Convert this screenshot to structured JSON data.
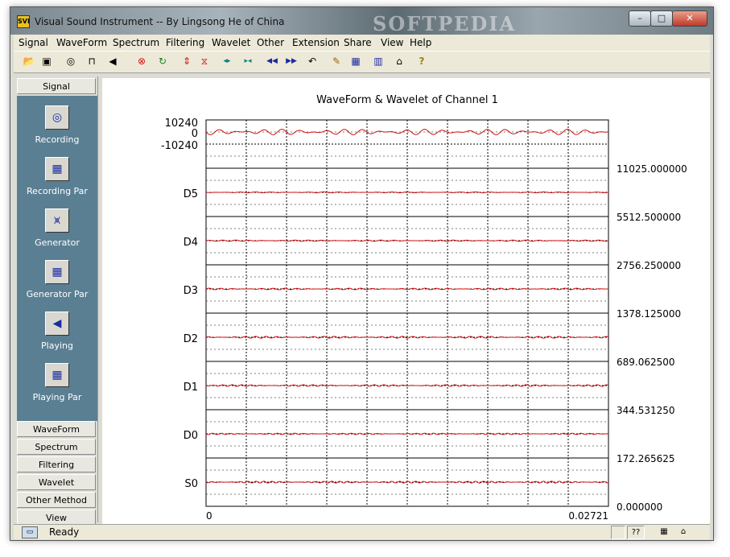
{
  "window": {
    "title": "Visual Sound Instrument -- By Lingsong He of China",
    "app_icon_text": "SVI",
    "watermark": "SOFTPEDIA",
    "minimize_glyph": "–",
    "maximize_glyph": "□",
    "close_glyph": "✕"
  },
  "menu": [
    "Signal",
    "WaveForm",
    "Spectrum",
    "Filtering",
    "Wavelet",
    "Other",
    "Extension",
    "Share",
    "View",
    "Help"
  ],
  "toolbar": [
    {
      "icon": "open-folder-icon",
      "glyph": "📂"
    },
    {
      "icon": "save-icon",
      "glyph": "▣"
    },
    {
      "icon": "record-icon",
      "glyph": "◎"
    },
    {
      "icon": "generator-icon",
      "glyph": "⊓"
    },
    {
      "icon": "speaker-icon",
      "glyph": "◀"
    },
    {
      "icon": "stop-icon",
      "glyph": "⊗"
    },
    {
      "icon": "refresh-icon",
      "glyph": "↻"
    },
    {
      "icon": "expand-vertical-icon",
      "glyph": "⇕"
    },
    {
      "icon": "compress-vertical-icon",
      "glyph": "⧖"
    },
    {
      "icon": "expand-horizontal-icon",
      "glyph": "◂▸"
    },
    {
      "icon": "compress-horizontal-icon",
      "glyph": "▸◂"
    },
    {
      "icon": "rewind-icon",
      "glyph": "◀◀"
    },
    {
      "icon": "forward-icon",
      "glyph": "▶▶"
    },
    {
      "icon": "undo-icon",
      "glyph": "↶"
    },
    {
      "icon": "tools-icon",
      "glyph": "✎"
    },
    {
      "icon": "grid-icon",
      "glyph": "▦"
    },
    {
      "icon": "books-icon",
      "glyph": "▥"
    },
    {
      "icon": "home-icon",
      "glyph": "⌂"
    },
    {
      "icon": "help-icon",
      "glyph": "?"
    }
  ],
  "sidebar": {
    "top_tab": "Signal",
    "items": [
      {
        "label": "Recording",
        "icon": "recording-icon",
        "glyph": "◎"
      },
      {
        "label": "Recording Par",
        "icon": "recording-params-icon",
        "glyph": "▦"
      },
      {
        "label": "Generator",
        "icon": "generator-icon",
        "glyph": "⩙"
      },
      {
        "label": "Generator Par",
        "icon": "generator-params-icon",
        "glyph": "▦"
      },
      {
        "label": "Playing",
        "icon": "speaker-icon",
        "glyph": "◀"
      },
      {
        "label": "Playing Par",
        "icon": "playing-params-icon",
        "glyph": "▦"
      }
    ],
    "bottom_tabs": [
      "WaveForm",
      "Spectrum",
      "Filtering",
      "Wavelet",
      "Other Method",
      "View"
    ]
  },
  "status": {
    "text": "Ready",
    "help_cell": "??"
  },
  "chart_data": {
    "type": "line",
    "title": "WaveForm & Wavelet of Channel 1",
    "x_range": [
      0,
      0.02721
    ],
    "x_tick_labels": [
      "0",
      "0.02721"
    ],
    "left_labels": [
      "10240",
      "0",
      "-10240",
      "D5",
      "D4",
      "D3",
      "D2",
      "D1",
      "D0",
      "S0"
    ],
    "right_labels": [
      "11025.000000",
      "5512.500000",
      "2756.250000",
      "1378.125000",
      "689.062500",
      "344.531250",
      "172.265625",
      "0.000000"
    ],
    "series_color": "#d01010",
    "grid": "dashed",
    "series": [
      {
        "band": 0,
        "amplitude": 3.5
      },
      {
        "band": 1,
        "amplitude": 0.6
      },
      {
        "band": 2,
        "amplitude": 0.8
      },
      {
        "band": 3,
        "amplitude": 1.0
      },
      {
        "band": 4,
        "amplitude": 1.2
      },
      {
        "band": 5,
        "amplitude": 1.1
      },
      {
        "band": 6,
        "amplitude": 0.9
      },
      {
        "band": 7,
        "amplitude": 1.3
      }
    ]
  }
}
